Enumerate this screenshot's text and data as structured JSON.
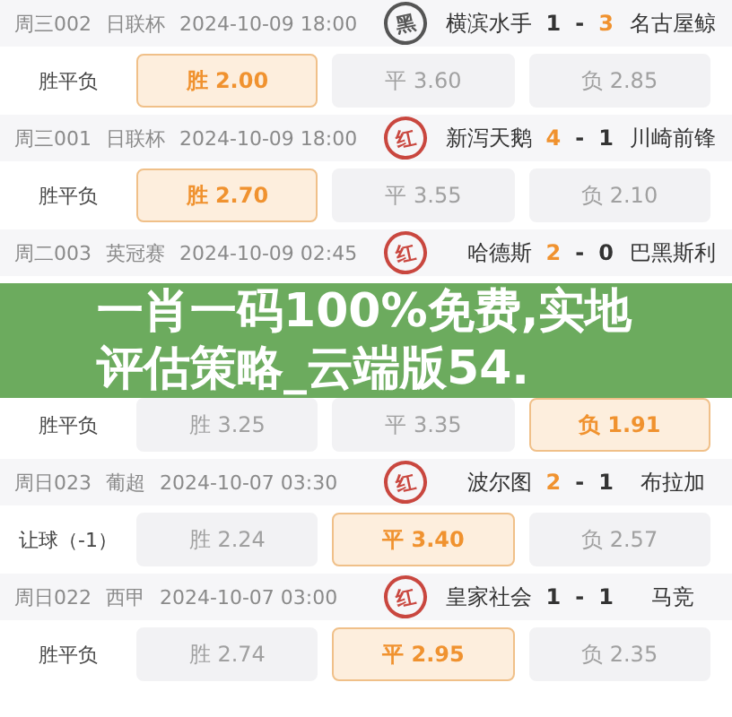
{
  "matches": [
    {
      "info": {
        "code": "周三002",
        "league": "日联杯",
        "time": "2024-10-09 18:00",
        "stamp": {
          "text": "黑",
          "kind": "black"
        },
        "home": "横滨水手",
        "home_goals": {
          "text": "1",
          "highlighted": false
        },
        "separator": "-",
        "away_goals": {
          "text": "3",
          "highlighted": true
        },
        "away": "名古屋鲸"
      },
      "odds": {
        "market": "胜平负",
        "options": [
          {
            "label": "胜 2.00",
            "selected": true
          },
          {
            "label": "平 3.60",
            "selected": false
          },
          {
            "label": "负 2.85",
            "selected": false
          }
        ]
      }
    },
    {
      "info": {
        "code": "周三001",
        "league": "日联杯",
        "time": "2024-10-09 18:00",
        "stamp": {
          "text": "红",
          "kind": "red"
        },
        "home": "新泻天鹅",
        "home_goals": {
          "text": "4",
          "highlighted": true
        },
        "separator": "-",
        "away_goals": {
          "text": "1",
          "highlighted": false
        },
        "away": "川崎前锋"
      },
      "odds": {
        "market": "胜平负",
        "options": [
          {
            "label": "胜 2.70",
            "selected": true
          },
          {
            "label": "平 3.55",
            "selected": false
          },
          {
            "label": "负 2.10",
            "selected": false
          }
        ]
      }
    },
    {
      "info": {
        "code": "周二003",
        "league": "英冠赛",
        "time": "2024-10-09 02:45",
        "stamp": {
          "text": "红",
          "kind": "red"
        },
        "home": "哈德斯",
        "home_goals": {
          "text": "2",
          "highlighted": true
        },
        "separator": "-",
        "away_goals": {
          "text": "0",
          "highlighted": false
        },
        "away": "巴黑斯利"
      }
    },
    {
      "odds": {
        "market": "胜平负",
        "options": [
          {
            "label": "胜 3.25",
            "selected": false
          },
          {
            "label": "平 3.35",
            "selected": false
          },
          {
            "label": "负 1.91",
            "selected": true
          }
        ]
      }
    },
    {
      "info": {
        "code": "周日023",
        "league": "葡超",
        "time": "2024-10-07 03:30",
        "stamp": {
          "text": "红",
          "kind": "red"
        },
        "home": "波尔图",
        "home_goals": {
          "text": "2",
          "highlighted": true
        },
        "separator": "-",
        "away_goals": {
          "text": "1",
          "highlighted": false
        },
        "away": "布拉加"
      },
      "odds": {
        "market": "让球（-1）",
        "options": [
          {
            "label": "胜 2.24",
            "selected": false
          },
          {
            "label": "平 3.40",
            "selected": true
          },
          {
            "label": "负 2.57",
            "selected": false
          }
        ]
      }
    },
    {
      "info": {
        "code": "周日022",
        "league": "西甲",
        "time": "2024-10-07 03:00",
        "stamp": {
          "text": "红",
          "kind": "red"
        },
        "home": "皇家社会",
        "home_goals": {
          "text": "1",
          "highlighted": false
        },
        "separator": "-",
        "away_goals": {
          "text": "1",
          "highlighted": false
        },
        "away": "马竞"
      },
      "odds": {
        "market": "胜平负",
        "options": [
          {
            "label": "胜 2.74",
            "selected": false
          },
          {
            "label": "平 2.95",
            "selected": true
          },
          {
            "label": "负 2.35",
            "selected": false
          }
        ]
      }
    }
  ],
  "banner": {
    "title": "一肖一码100%免费,实地评估策略_云端版54."
  }
}
